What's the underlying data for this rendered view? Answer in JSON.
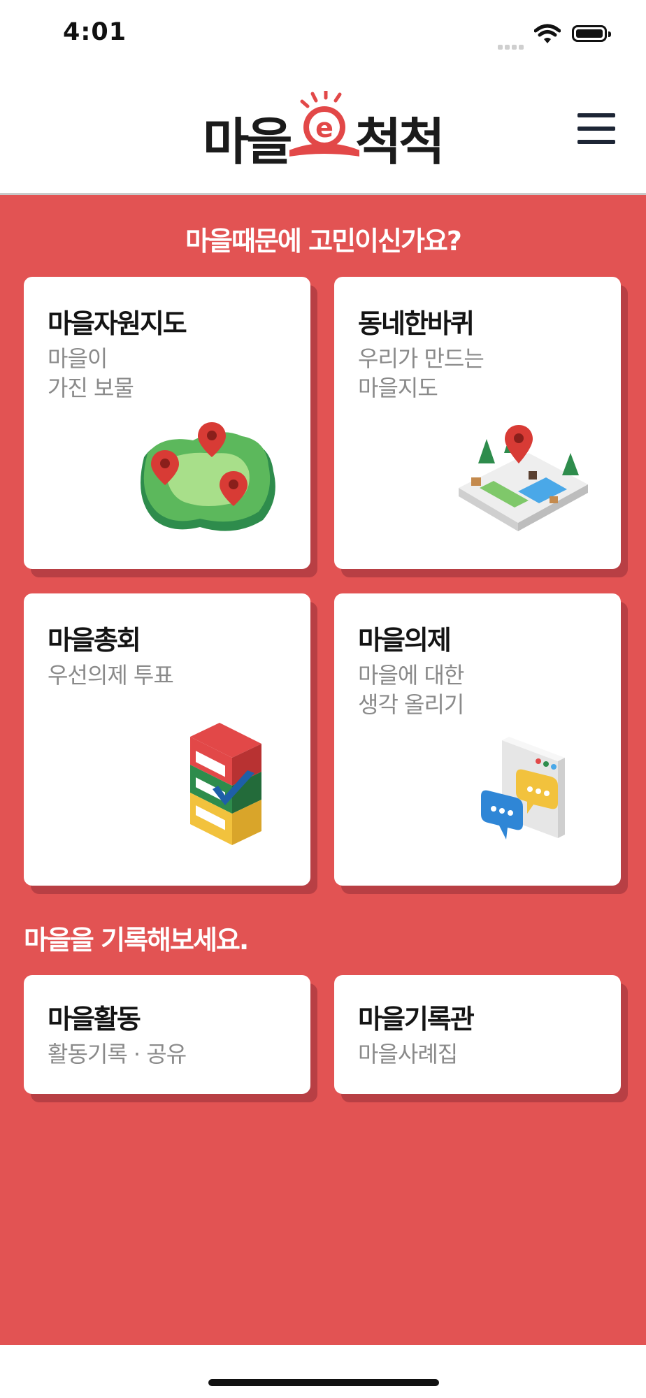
{
  "status_bar": {
    "time": "4:01"
  },
  "header": {
    "logo_left": "마을",
    "logo_right": "척척",
    "logo_mark": "e"
  },
  "sections": {
    "problem_title": "마을때문에 고민이신가요?",
    "record_title": "마을을 기록해보세요."
  },
  "cards": [
    {
      "title": "마을자원지도",
      "desc_line1": "마을이",
      "desc_line2": "가진 보물",
      "icon": "village-map-icon"
    },
    {
      "title": "동네한바퀴",
      "desc_line1": "우리가 만드는",
      "desc_line2": "마을지도",
      "icon": "neighborhood-map-pin-icon"
    },
    {
      "title": "마을총회",
      "desc_line1": "우선의제 투표",
      "desc_line2": "",
      "icon": "ballot-box-icon"
    },
    {
      "title": "마을의제",
      "desc_line1": "마을에 대한",
      "desc_line2": "생각 올리기",
      "icon": "speech-bubbles-icon"
    }
  ],
  "record_cards": [
    {
      "title": "마을활동",
      "desc": "활동기록 · 공유"
    },
    {
      "title": "마을기록관",
      "desc": "마을사례집"
    }
  ],
  "colors": {
    "brand_red": "#e25353",
    "card_shadow": "#b83f44",
    "text_dark": "#141414",
    "text_muted": "#8a8a8a"
  }
}
